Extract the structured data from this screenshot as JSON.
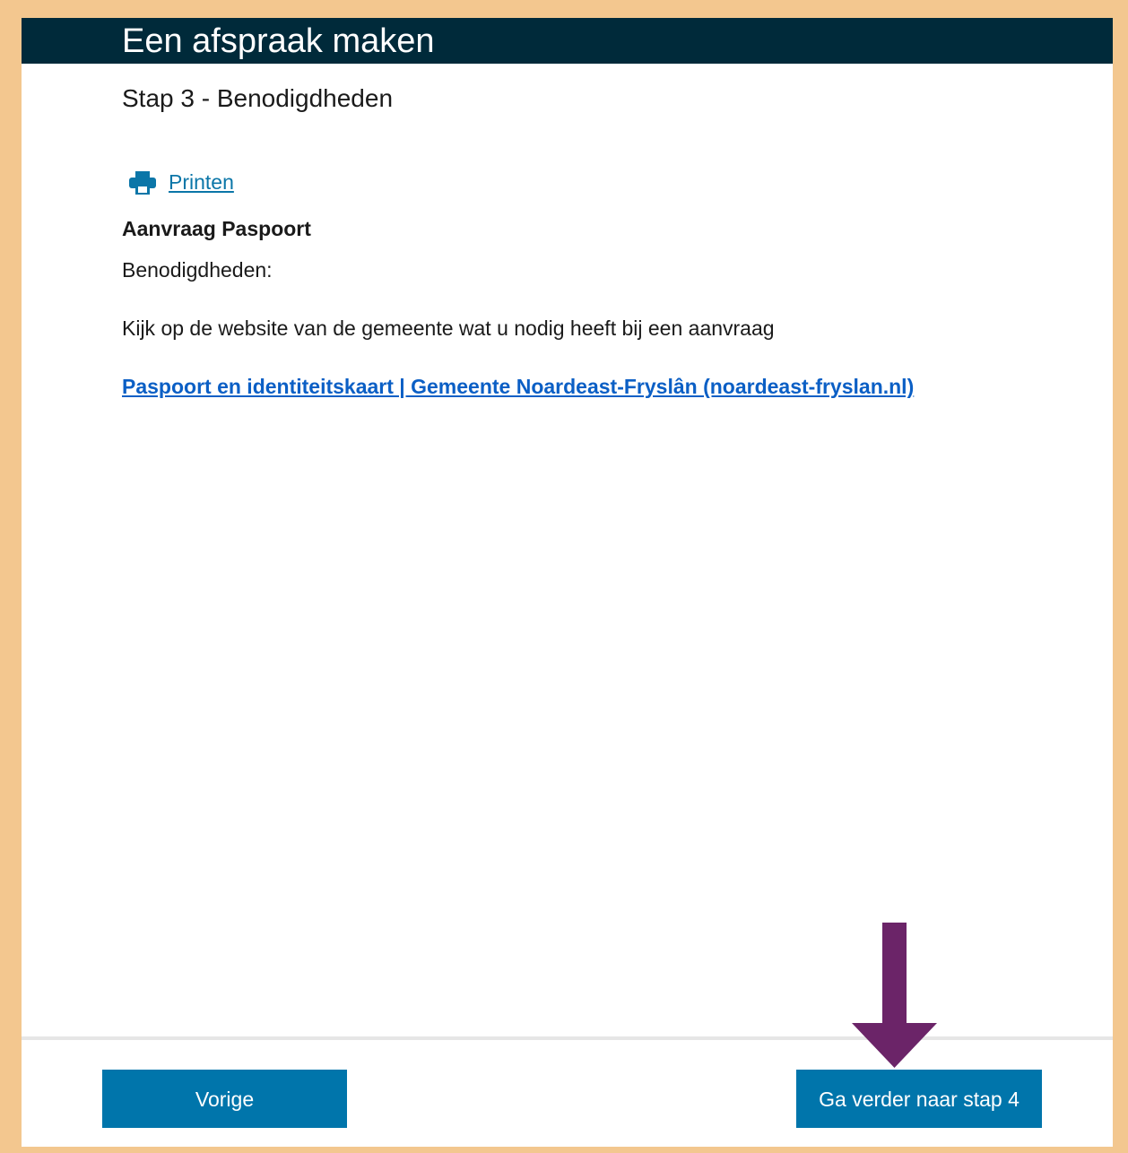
{
  "header": {
    "title": "Een afspraak maken"
  },
  "step": {
    "title": "Stap 3 - Benodigdheden"
  },
  "print": {
    "label": "Printen",
    "icon": "printer-icon"
  },
  "request": {
    "title": "Aanvraag Paspoort",
    "subtitle": "Benodigdheden:",
    "description": "Kijk op de website van de gemeente wat u nodig heeft bij een aanvraag",
    "link_text": "Paspoort en identiteitskaart | Gemeente Noardeast-Fryslân (noardeast-fryslan.nl)"
  },
  "footer": {
    "prev_label": "Vorige",
    "next_label": "Ga verder naar stap 4"
  },
  "colors": {
    "header_bg": "#002a3a",
    "button_bg": "#0075ab",
    "link": "#0b76a8",
    "annotation_arrow": "#6b2468",
    "page_border": "#f3c78f"
  }
}
